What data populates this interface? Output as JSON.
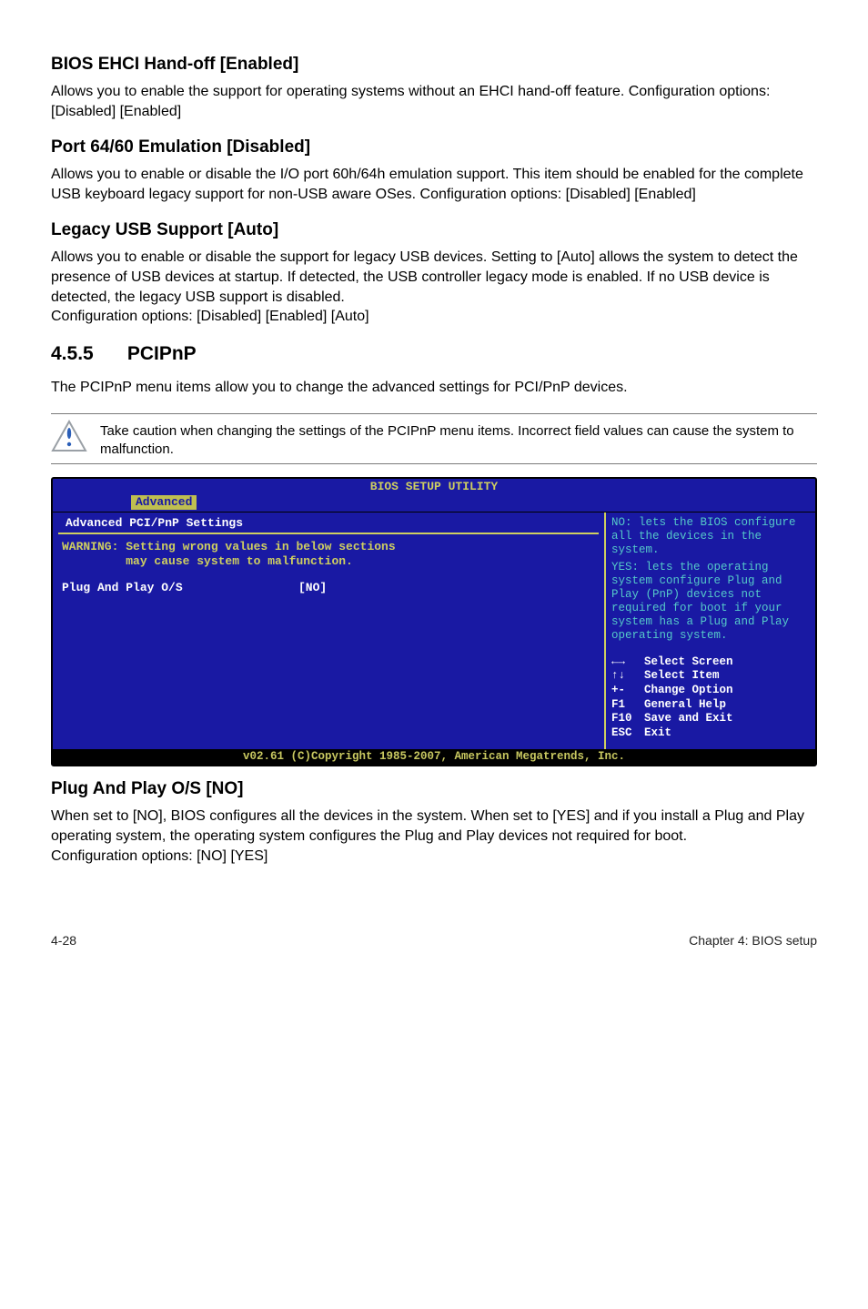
{
  "s1": {
    "title": "BIOS EHCI Hand-off [Enabled]",
    "para": "Allows you to enable the support for operating systems without an EHCI hand-off feature. Configuration options: [Disabled] [Enabled]"
  },
  "s2": {
    "title": "Port 64/60 Emulation [Disabled]",
    "para": "Allows you to enable or disable the I/O port 60h/64h emulation support. This item should be enabled for the complete USB keyboard legacy support for non-USB aware OSes. Configuration options: [Disabled] [Enabled]"
  },
  "s3": {
    "title": "Legacy USB Support [Auto]",
    "para1": "Allows you to enable or disable the support for legacy USB devices. Setting to [Auto] allows the system to detect the presence of USB devices at startup. If detected, the USB controller legacy mode is enabled. If no USB device is detected, the legacy USB support is disabled.",
    "para2": "Configuration options: [Disabled] [Enabled] [Auto]"
  },
  "section": {
    "num": "4.5.5",
    "title": "PCIPnP",
    "intro": "The PCIPnP menu items allow you to change the advanced settings for PCI/PnP devices."
  },
  "callout": "Take caution when changing the settings of the PCIPnP menu items. Incorrect field values can cause the system to malfunction.",
  "bios": {
    "title": "BIOS SETUP UTILITY",
    "tab": "Advanced",
    "header": "Advanced PCI/PnP Settings",
    "warn1": "WARNING: Setting wrong values in below sections",
    "warn2": "         may cause system to malfunction.",
    "row_label": "Plug And Play O/S",
    "row_val": "[NO]",
    "help1": "NO: lets the BIOS configure all the devices in the system.",
    "help2": "YES: lets the operating system configure Plug and Play (PnP) devices not required for boot if your system has a Plug and Play operating system.",
    "keys": {
      "k1": {
        "k": "←→",
        "t": "Select Screen"
      },
      "k2": {
        "k": "↑↓",
        "t": "Select Item"
      },
      "k3": {
        "k": "+-",
        "t": "Change Option"
      },
      "k4": {
        "k": "F1",
        "t": "General Help"
      },
      "k5": {
        "k": "F10",
        "t": "Save and Exit"
      },
      "k6": {
        "k": "ESC",
        "t": "Exit"
      }
    },
    "footer": "v02.61 (C)Copyright 1985-2007, American Megatrends, Inc."
  },
  "s4": {
    "title": "Plug And Play O/S [NO]",
    "para1": "When set to [NO], BIOS configures all the devices in the system. When set to [YES] and if you install a Plug and Play operating system, the operating system configures the Plug and Play devices not required for boot.",
    "para2": "Configuration options: [NO] [YES]"
  },
  "footer": {
    "left": "4-28",
    "right": "Chapter 4: BIOS setup"
  }
}
